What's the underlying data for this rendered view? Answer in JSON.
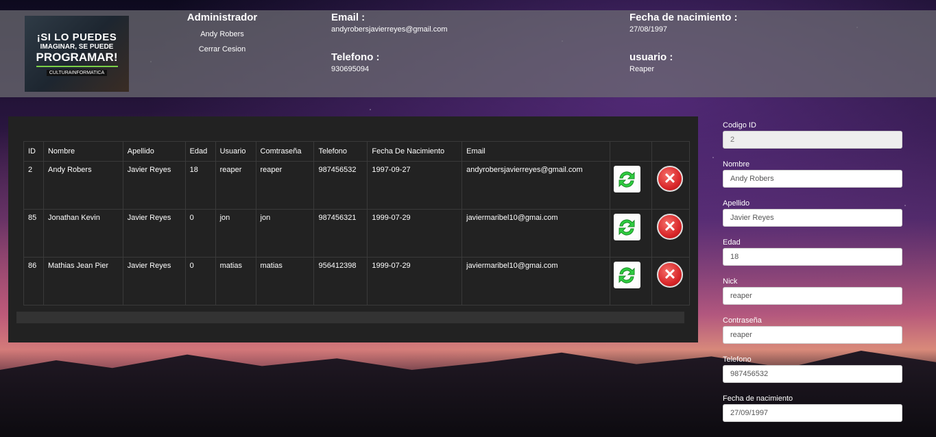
{
  "header": {
    "logo": {
      "line1": "¡SI LO PUEDES",
      "line2": "IMAGINAR, SE PUEDE",
      "line3": "PROGRAMAR!",
      "line4": "CULTURAINFORMATICA"
    },
    "role": "Administrador",
    "user_name": "Andy Robers",
    "logout_label": "Cerrar Cesion",
    "email_label": "Email :",
    "email_value": "andyrobersjavierreyes@gmail.com",
    "phone_label": "Telefono :",
    "phone_value": "930695094",
    "birth_label": "Fecha de nacimiento :",
    "birth_value": "27/08/1997",
    "username_label": "usuario :",
    "username_value": "Reaper"
  },
  "table": {
    "columns": [
      "ID",
      "Nombre",
      "Apellido",
      "Edad",
      "Usuario",
      "Comtraseña",
      "Telefono",
      "Fecha De Nacimiento",
      "Email"
    ],
    "rows": [
      [
        "2",
        "Andy Robers",
        "Javier Reyes",
        "18",
        "reaper",
        "reaper",
        "987456532",
        "1997-09-27",
        "andyrobersjavierreyes@gmail.com"
      ],
      [
        "85",
        "Jonathan Kevin",
        "Javier Reyes",
        "0",
        "jon",
        "jon",
        "987456321",
        "1999-07-29",
        "javiermaribel10@gmai.com"
      ],
      [
        "86",
        "Mathias Jean Pier",
        "Javier Reyes",
        "0",
        "matias",
        "matias",
        "956412398",
        "1999-07-29",
        "javiermaribel10@gmai.com"
      ]
    ]
  },
  "form": {
    "fields": [
      {
        "label": "Codigo ID",
        "value": "2"
      },
      {
        "label": "Nombre",
        "value": "Andy Robers"
      },
      {
        "label": "Apellido",
        "value": "Javier Reyes"
      },
      {
        "label": "Edad",
        "value": "18"
      },
      {
        "label": "Nick",
        "value": "reaper"
      },
      {
        "label": "Contraseña",
        "value": "reaper"
      },
      {
        "label": "Telefono",
        "value": "987456532"
      },
      {
        "label": "Fecha de nacimiento",
        "value": "27/09/1997"
      }
    ]
  },
  "colors": {
    "header_bg": "#6e6e73",
    "panel_bg": "#222222",
    "refresh_green": "#2ecc40",
    "delete_red": "#d9272a"
  },
  "icons": {
    "refresh": "refresh-icon",
    "delete": "delete-icon"
  }
}
